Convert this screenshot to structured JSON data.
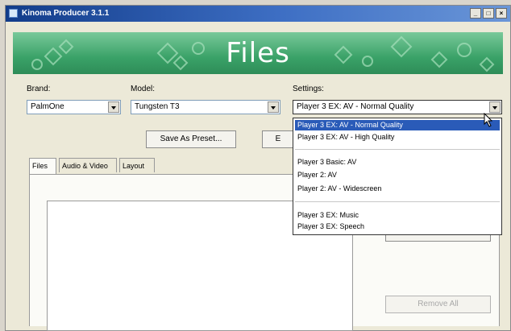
{
  "window": {
    "title": "Kinoma Producer 3.1.1",
    "min_label": "_",
    "max_label": "□",
    "close_label": "×"
  },
  "banner": {
    "title": "Files"
  },
  "brand": {
    "label": "Brand:",
    "value": "PalmOne"
  },
  "model": {
    "label": "Model:",
    "value": "Tungsten T3"
  },
  "settings": {
    "label": "Settings:",
    "value": "Player 3 EX: AV - Normal Quality",
    "options": [
      "Player 3 EX: AV - Normal Quality",
      "Player 3 EX: AV - High Quality",
      "Player 3 Basic: AV",
      "Player 2: AV",
      "Player 2: AV - Widescreen",
      "Player 3 EX: Music",
      "Player 3 EX: Speech"
    ]
  },
  "buttons": {
    "save_preset": "Save As Preset...",
    "edit_partial": "E",
    "remove": "Remove All"
  },
  "tabs": [
    "Files",
    "Audio & Video",
    "Layout"
  ]
}
